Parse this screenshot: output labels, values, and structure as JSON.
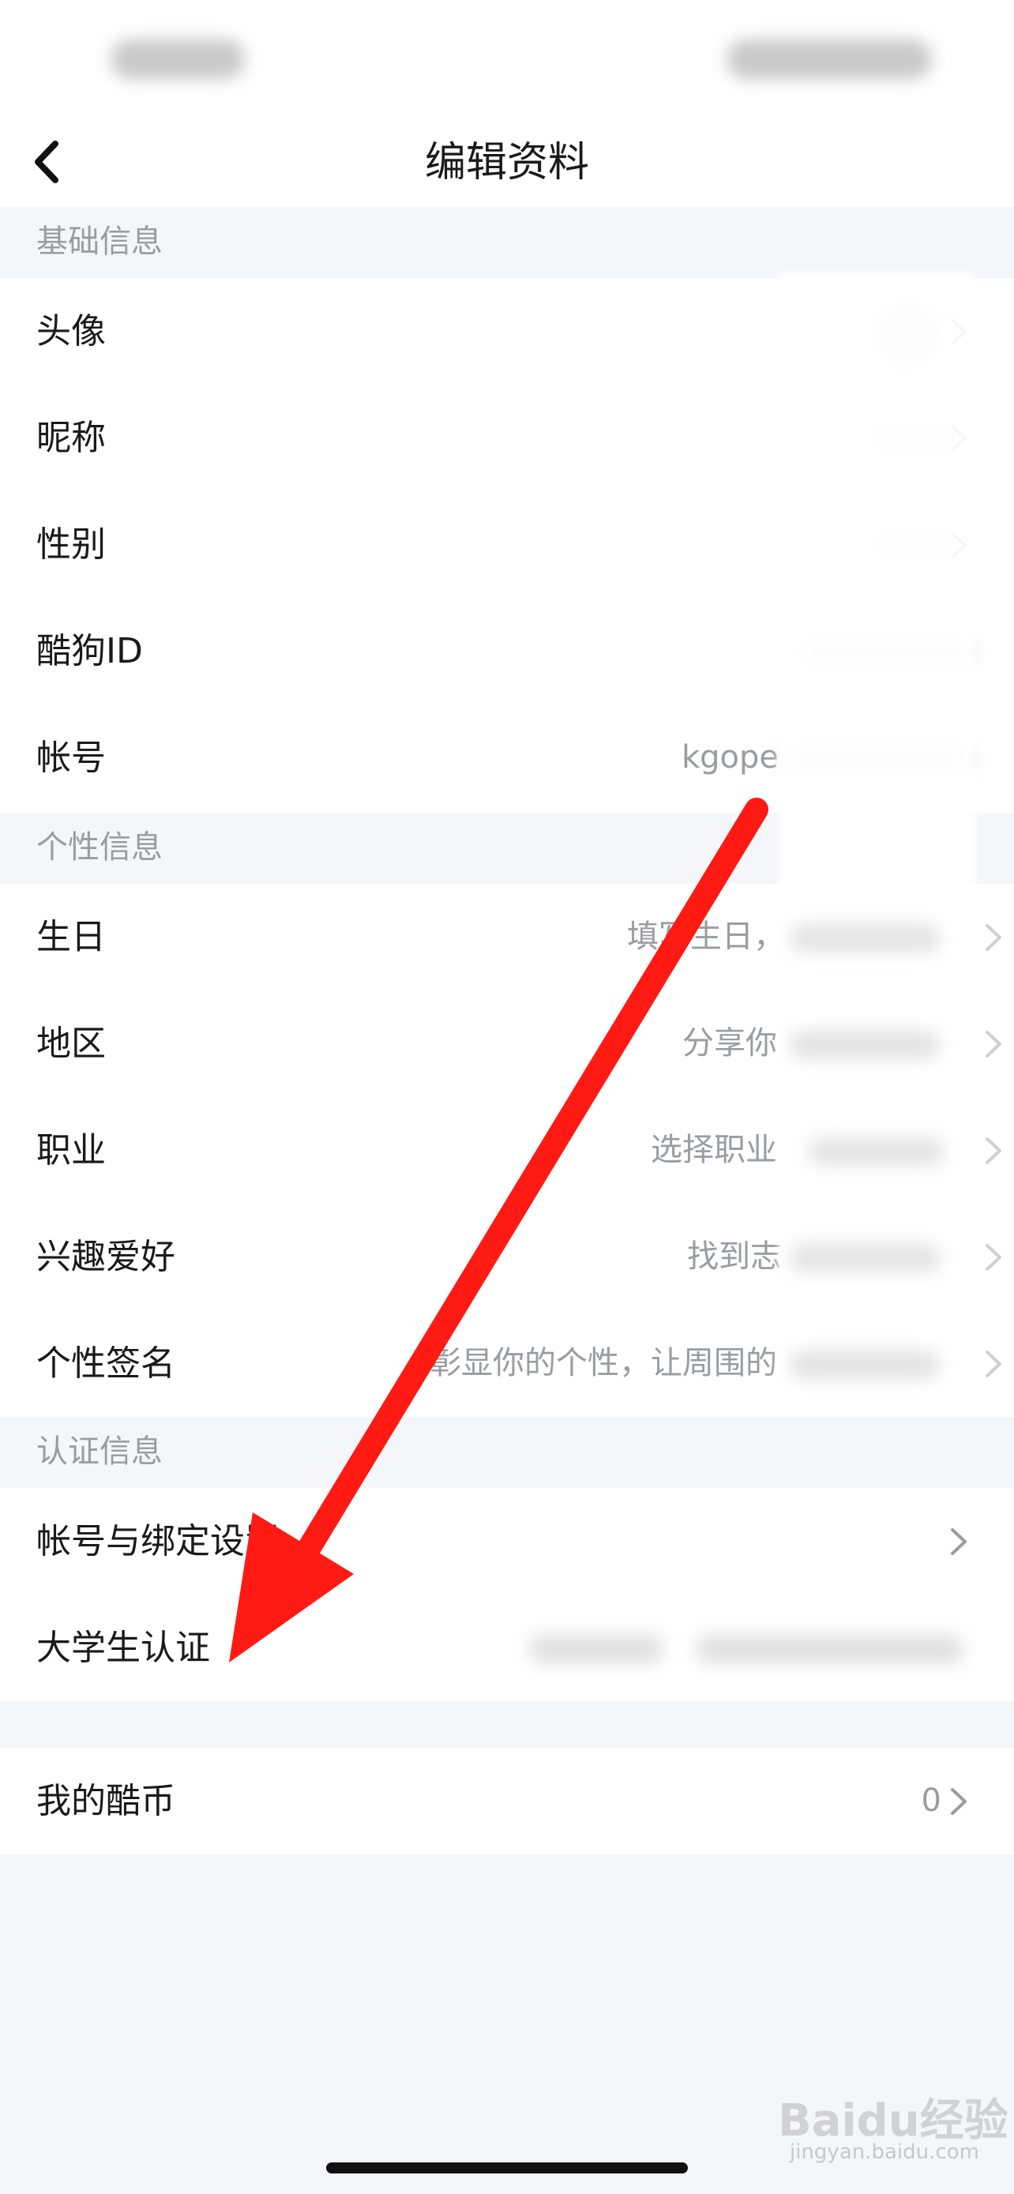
{
  "nav": {
    "title": "编辑资料"
  },
  "sections": {
    "basic": "基础信息",
    "personal": "个性信息",
    "verify": "认证信息"
  },
  "basic_rows": [
    {
      "label": "头像",
      "value": ""
    },
    {
      "label": "昵称",
      "value": ""
    },
    {
      "label": "性别",
      "value": ""
    },
    {
      "label": "酷狗ID",
      "value": ""
    },
    {
      "label": "帐号",
      "value": "kgope"
    }
  ],
  "personal_rows": [
    {
      "label": "生日",
      "value": "填写生日，"
    },
    {
      "label": "地区",
      "value": "分享你"
    },
    {
      "label": "职业",
      "value": "选择职业"
    },
    {
      "label": "兴趣爱好",
      "value": "找到志"
    },
    {
      "label": "个性签名",
      "value": "彰显你的个性，让周围的"
    }
  ],
  "verify_rows": [
    {
      "label": "帐号与绑定设置",
      "value": ""
    },
    {
      "label": "大学生认证",
      "value": ""
    }
  ],
  "coins": {
    "label": "我的酷币",
    "value": "0"
  },
  "watermark": {
    "brand": "Baidu经验",
    "url": "jingyan.baidu.com"
  },
  "colors": {
    "arrow": "#ff1a14",
    "background": "#f5f6fa",
    "secondary_text": "#9a9ca2"
  },
  "icons": [
    "back-arrow-icon",
    "chevron-right-icon"
  ]
}
